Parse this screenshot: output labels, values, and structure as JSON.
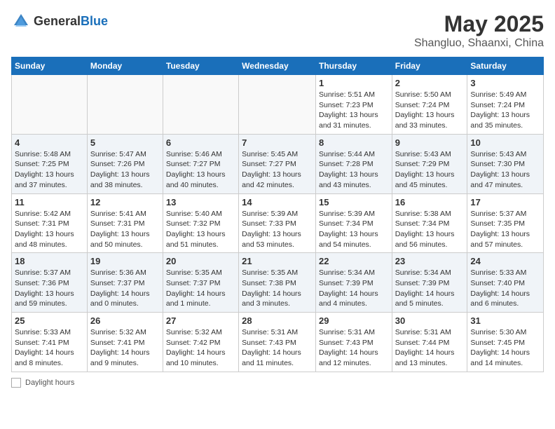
{
  "header": {
    "logo_general": "General",
    "logo_blue": "Blue",
    "month": "May 2025",
    "location": "Shangluo, Shaanxi, China"
  },
  "weekdays": [
    "Sunday",
    "Monday",
    "Tuesday",
    "Wednesday",
    "Thursday",
    "Friday",
    "Saturday"
  ],
  "weeks": [
    [
      {
        "day": "",
        "info": ""
      },
      {
        "day": "",
        "info": ""
      },
      {
        "day": "",
        "info": ""
      },
      {
        "day": "",
        "info": ""
      },
      {
        "day": "1",
        "info": "Sunrise: 5:51 AM\nSunset: 7:23 PM\nDaylight: 13 hours and 31 minutes."
      },
      {
        "day": "2",
        "info": "Sunrise: 5:50 AM\nSunset: 7:24 PM\nDaylight: 13 hours and 33 minutes."
      },
      {
        "day": "3",
        "info": "Sunrise: 5:49 AM\nSunset: 7:24 PM\nDaylight: 13 hours and 35 minutes."
      }
    ],
    [
      {
        "day": "4",
        "info": "Sunrise: 5:48 AM\nSunset: 7:25 PM\nDaylight: 13 hours and 37 minutes."
      },
      {
        "day": "5",
        "info": "Sunrise: 5:47 AM\nSunset: 7:26 PM\nDaylight: 13 hours and 38 minutes."
      },
      {
        "day": "6",
        "info": "Sunrise: 5:46 AM\nSunset: 7:27 PM\nDaylight: 13 hours and 40 minutes."
      },
      {
        "day": "7",
        "info": "Sunrise: 5:45 AM\nSunset: 7:27 PM\nDaylight: 13 hours and 42 minutes."
      },
      {
        "day": "8",
        "info": "Sunrise: 5:44 AM\nSunset: 7:28 PM\nDaylight: 13 hours and 43 minutes."
      },
      {
        "day": "9",
        "info": "Sunrise: 5:43 AM\nSunset: 7:29 PM\nDaylight: 13 hours and 45 minutes."
      },
      {
        "day": "10",
        "info": "Sunrise: 5:43 AM\nSunset: 7:30 PM\nDaylight: 13 hours and 47 minutes."
      }
    ],
    [
      {
        "day": "11",
        "info": "Sunrise: 5:42 AM\nSunset: 7:31 PM\nDaylight: 13 hours and 48 minutes."
      },
      {
        "day": "12",
        "info": "Sunrise: 5:41 AM\nSunset: 7:31 PM\nDaylight: 13 hours and 50 minutes."
      },
      {
        "day": "13",
        "info": "Sunrise: 5:40 AM\nSunset: 7:32 PM\nDaylight: 13 hours and 51 minutes."
      },
      {
        "day": "14",
        "info": "Sunrise: 5:39 AM\nSunset: 7:33 PM\nDaylight: 13 hours and 53 minutes."
      },
      {
        "day": "15",
        "info": "Sunrise: 5:39 AM\nSunset: 7:34 PM\nDaylight: 13 hours and 54 minutes."
      },
      {
        "day": "16",
        "info": "Sunrise: 5:38 AM\nSunset: 7:34 PM\nDaylight: 13 hours and 56 minutes."
      },
      {
        "day": "17",
        "info": "Sunrise: 5:37 AM\nSunset: 7:35 PM\nDaylight: 13 hours and 57 minutes."
      }
    ],
    [
      {
        "day": "18",
        "info": "Sunrise: 5:37 AM\nSunset: 7:36 PM\nDaylight: 13 hours and 59 minutes."
      },
      {
        "day": "19",
        "info": "Sunrise: 5:36 AM\nSunset: 7:37 PM\nDaylight: 14 hours and 0 minutes."
      },
      {
        "day": "20",
        "info": "Sunrise: 5:35 AM\nSunset: 7:37 PM\nDaylight: 14 hours and 1 minute."
      },
      {
        "day": "21",
        "info": "Sunrise: 5:35 AM\nSunset: 7:38 PM\nDaylight: 14 hours and 3 minutes."
      },
      {
        "day": "22",
        "info": "Sunrise: 5:34 AM\nSunset: 7:39 PM\nDaylight: 14 hours and 4 minutes."
      },
      {
        "day": "23",
        "info": "Sunrise: 5:34 AM\nSunset: 7:39 PM\nDaylight: 14 hours and 5 minutes."
      },
      {
        "day": "24",
        "info": "Sunrise: 5:33 AM\nSunset: 7:40 PM\nDaylight: 14 hours and 6 minutes."
      }
    ],
    [
      {
        "day": "25",
        "info": "Sunrise: 5:33 AM\nSunset: 7:41 PM\nDaylight: 14 hours and 8 minutes."
      },
      {
        "day": "26",
        "info": "Sunrise: 5:32 AM\nSunset: 7:41 PM\nDaylight: 14 hours and 9 minutes."
      },
      {
        "day": "27",
        "info": "Sunrise: 5:32 AM\nSunset: 7:42 PM\nDaylight: 14 hours and 10 minutes."
      },
      {
        "day": "28",
        "info": "Sunrise: 5:31 AM\nSunset: 7:43 PM\nDaylight: 14 hours and 11 minutes."
      },
      {
        "day": "29",
        "info": "Sunrise: 5:31 AM\nSunset: 7:43 PM\nDaylight: 14 hours and 12 minutes."
      },
      {
        "day": "30",
        "info": "Sunrise: 5:31 AM\nSunset: 7:44 PM\nDaylight: 14 hours and 13 minutes."
      },
      {
        "day": "31",
        "info": "Sunrise: 5:30 AM\nSunset: 7:45 PM\nDaylight: 14 hours and 14 minutes."
      }
    ]
  ],
  "legend": {
    "label": "Daylight hours"
  }
}
